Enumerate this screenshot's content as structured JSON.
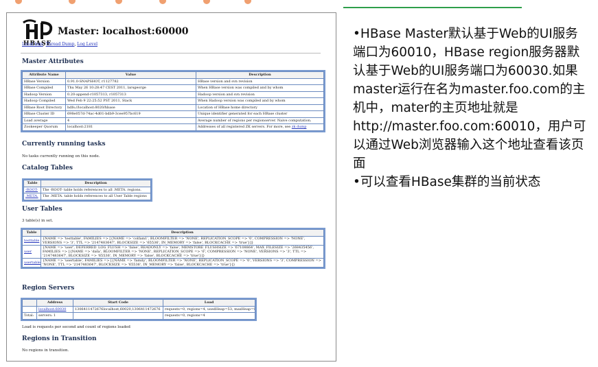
{
  "page": {
    "title": "Master: localhost:60000",
    "logo_text": "HBASE",
    "top_links": [
      "Local logs",
      "Thread Dump",
      "Log Level"
    ]
  },
  "master_attributes": {
    "heading": "Master Attributes",
    "columns": [
      "Attribute Name",
      "Value",
      "Description"
    ],
    "rows": [
      [
        "HBase Version",
        "0.91.0-SNAPSHOT, r1127782",
        "HBase version and svn revision"
      ],
      [
        "HBase Compiled",
        "Thu May 26 10:28:47 CEST 2011, larsgeorge",
        "When HBase version was compiled and by whom"
      ],
      [
        "Hadoop Version",
        "0.20-append-r1057313, r1057313",
        "Hadoop version and svn revision"
      ],
      [
        "Hadoop Compiled",
        "Wed Feb 9 22:25:52 PST 2011, Stack",
        "When Hadoop version was compiled and by whom"
      ],
      [
        "HBase Root Directory",
        "hdfs://localhost:8020/hbase",
        "Location of HBase home directory"
      ],
      [
        "HBase Cluster ID",
        "698e057d-74ac-4d01-bdb9-3cee957bc619",
        "Unique identifier generated for each HBase cluster"
      ],
      [
        "Load average",
        "4",
        "Average number of regions per regionserver. Naive computation."
      ],
      [
        "Zookeeper Quorum",
        "localhost:2181",
        "Addresses of all registered ZK servers. For more, see"
      ]
    ],
    "zk_link": "zk dump"
  },
  "running_tasks": {
    "heading": "Currently running tasks",
    "text": "No tasks currently running on this node."
  },
  "catalog_tables": {
    "heading": "Catalog Tables",
    "columns": [
      "Table",
      "Description"
    ],
    "rows": [
      [
        "-ROOT-",
        "The -ROOT- table holds references to all .META. regions."
      ],
      [
        ".META.",
        "The .META. table holds references to all User Table regions"
      ]
    ]
  },
  "user_tables": {
    "heading": "User Tables",
    "count_text": "3 table(s) in set.",
    "columns": [
      "Table",
      "Description"
    ],
    "rows": [
      [
        "testtable",
        "{NAME => 'testtable', FAMILIES => [{NAME => 'colfam1', BLOOMFILTER => 'NONE', REPLICATION_SCOPE => '0', COMPRESSION => 'NONE', VERSIONS => '3', TTL => '2147483647', BLOCKSIZE => '65536', IN_MEMORY => 'false', BLOCKCACHE => 'true'}]}"
      ],
      [
        "user",
        "{NAME => 'user', DEFERRED_LOG_FLUSH => 'false', READONLY => 'false', MEMSTORE_FLUSHSIZE => '67108864', MAX_FILESIZE => '268435456', FAMILIES => [{NAME => 'data', BLOOMFILTER => 'NONE', REPLICATION_SCOPE => '0', COMPRESSION => 'NONE', VERSIONS => '3', TTL => '2147483647', BLOCKSIZE => '65536', IN_MEMORY => 'false', BLOCKCACHE => 'true'}]}"
      ],
      [
        "usertable",
        "{NAME => 'usertable', FAMILIES => [{NAME => 'family', BLOOMFILTER => 'NONE', REPLICATION_SCOPE => '0', VERSIONS => '3', COMPRESSION => 'NONE', TTL => '2147483647', BLOCKSIZE => '65536', IN_MEMORY => 'false', BLOCKCACHE => 'true'}]}"
      ]
    ]
  },
  "region_servers": {
    "heading": "Region Servers",
    "columns": [
      "",
      "Address",
      "Start Code",
      "Load"
    ],
    "rows": [
      [
        "",
        "localhost:60030",
        "1306411472676localhost,60020,1306411472676",
        "requests=0, regions=4, usedHeap=53, maxHeap=987"
      ],
      [
        "Total:",
        "servers: 1",
        "",
        "requests=0, regions=4"
      ]
    ],
    "footnote": "Load is requests per second and count of regions loaded"
  },
  "regions_in_transition": {
    "heading": "Regions in Transition",
    "text": "No regions in transition."
  },
  "notes": [
    "•HBase Master默认基于Web的UI服务端口为60010，HBase region服务器默认基于Web的UI服务端口为60030.如果master运行在名为master.foo.com的主机中，mater的主页地址就是http://master.foo.com:60010，用户可以通过Web浏览器输入这个地址查看该页面",
    "•可以查看HBase集群的当前状态"
  ]
}
